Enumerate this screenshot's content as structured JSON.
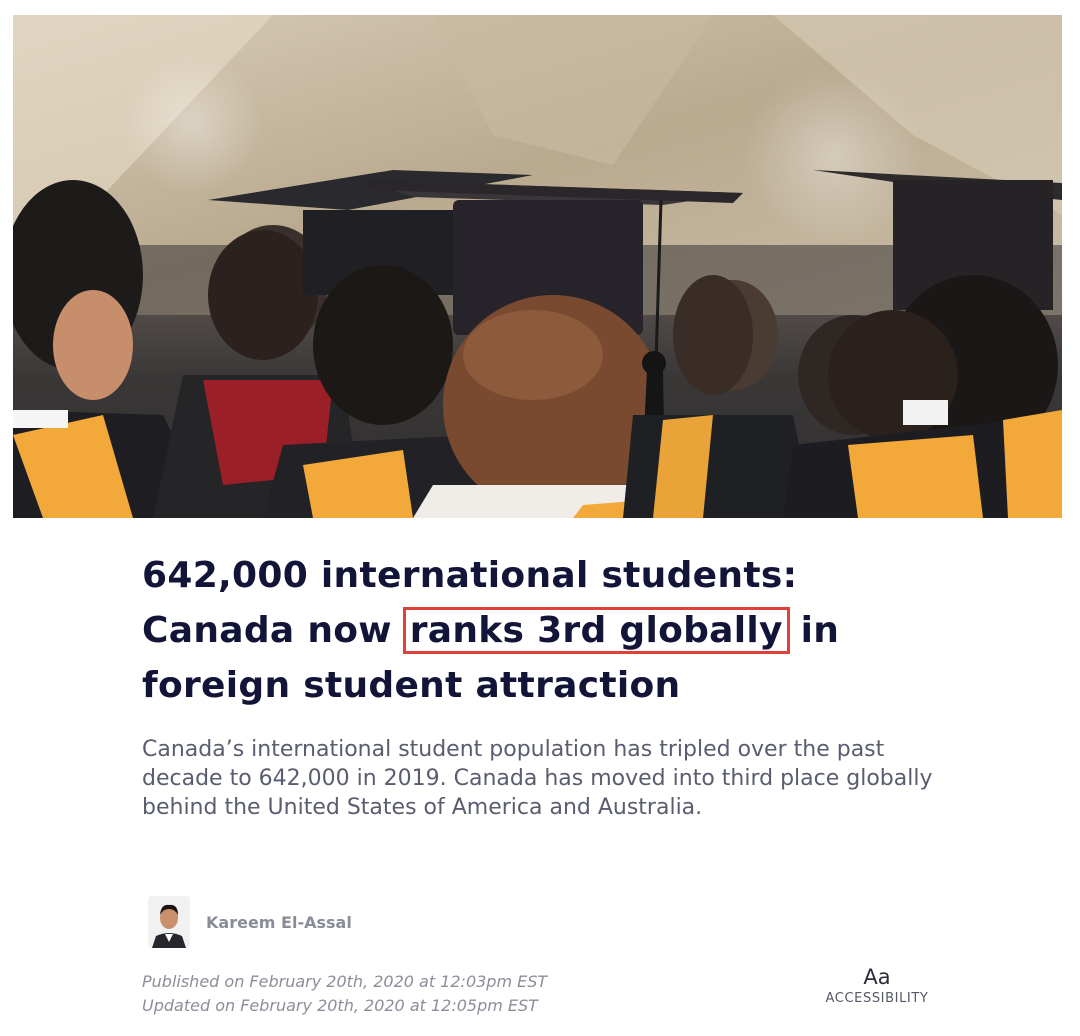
{
  "article": {
    "headline": {
      "part1": "642,000 international students: Canada now ",
      "highlight": "ranks 3rd globally",
      "part2": " in foreign student attraction"
    },
    "standfirst": "Canada’s international student population has tripled over the past decade to 642,000 in 2019. Canada has moved into third place globally behind the United States of America and Australia.",
    "author": "Kareem El-Assal",
    "published": "Published on February 20th, 2020 at 12:03pm EST",
    "updated": "Updated on February 20th, 2020 at 12:05pm EST"
  },
  "accessibility": {
    "glyph": "Aa",
    "label": "ACCESSIBILITY"
  },
  "colors": {
    "headline": "#121538",
    "highlight_border": "#e0403a",
    "body_text": "#5a5d70",
    "meta_text": "#8b8e99",
    "gown_stole": "#f2a93a"
  }
}
